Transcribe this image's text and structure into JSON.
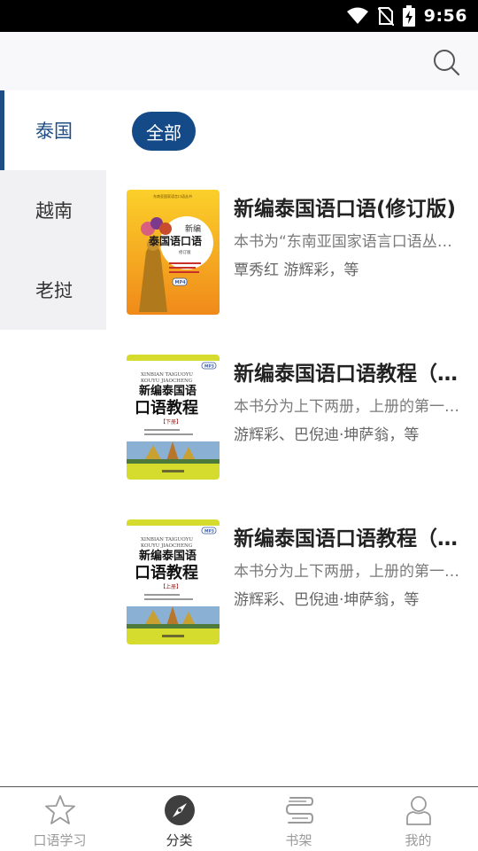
{
  "status_bar": {
    "time": "9:56",
    "icons": [
      "wifi-icon",
      "no-sim-icon",
      "battery-charging-icon"
    ]
  },
  "header": {
    "search_icon": "search-icon"
  },
  "categories": [
    {
      "label": "泰国",
      "active": true
    },
    {
      "label": "越南",
      "active": false
    },
    {
      "label": "老挝",
      "active": false
    }
  ],
  "filter": {
    "label": "全部"
  },
  "books": [
    {
      "title": "新编泰国语口语(修订版)",
      "description": "本书为“东南亚国家语言口语丛书”之一",
      "authors": "覃秀红 游辉彩，等",
      "cover": {
        "series": "东南亚国家语言口语丛书",
        "title_line1": "新编",
        "title_line2": "泰国语口语",
        "edition": "修订版",
        "badge": "MP4",
        "accent": "#f29a1d"
      }
    },
    {
      "title": "新编泰国语口语教程（下册）",
      "description": "本书分为上下两册，上册的第一部分",
      "authors": "游辉彩、巴倪迪·坤萨翁，等",
      "cover": {
        "pinyin1": "XINBIAN TAIGUOYU",
        "pinyin2": "KOUYU JIAOCHENG",
        "title_line1": "新编泰国语",
        "title_line2": "口语教程",
        "volume": "【下册】",
        "badge": "MP3",
        "accent": "#d5dc2e"
      }
    },
    {
      "title": "新编泰国语口语教程（上册）",
      "description": "本书分为上下两册，上册的第一部分",
      "authors": "游辉彩、巴倪迪·坤萨翁，等",
      "cover": {
        "pinyin1": "XINBIAN TAIGUOYU",
        "pinyin2": "KOUYU JIAOCHENG",
        "title_line1": "新编泰国语",
        "title_line2": "口语教程",
        "volume": "【上册】",
        "badge": "MP3",
        "accent": "#d5dc2e"
      }
    }
  ],
  "bottom_nav": [
    {
      "label": "口语学习",
      "icon": "star-icon",
      "active": false
    },
    {
      "label": "分类",
      "icon": "compass-icon",
      "active": true
    },
    {
      "label": "书架",
      "icon": "bookshelf-icon",
      "active": false
    },
    {
      "label": "我的",
      "icon": "person-icon",
      "active": false
    }
  ],
  "colors": {
    "primary": "#134a87",
    "active_category": "#1f4d86",
    "inactive_nav": "#9a9a9a"
  }
}
